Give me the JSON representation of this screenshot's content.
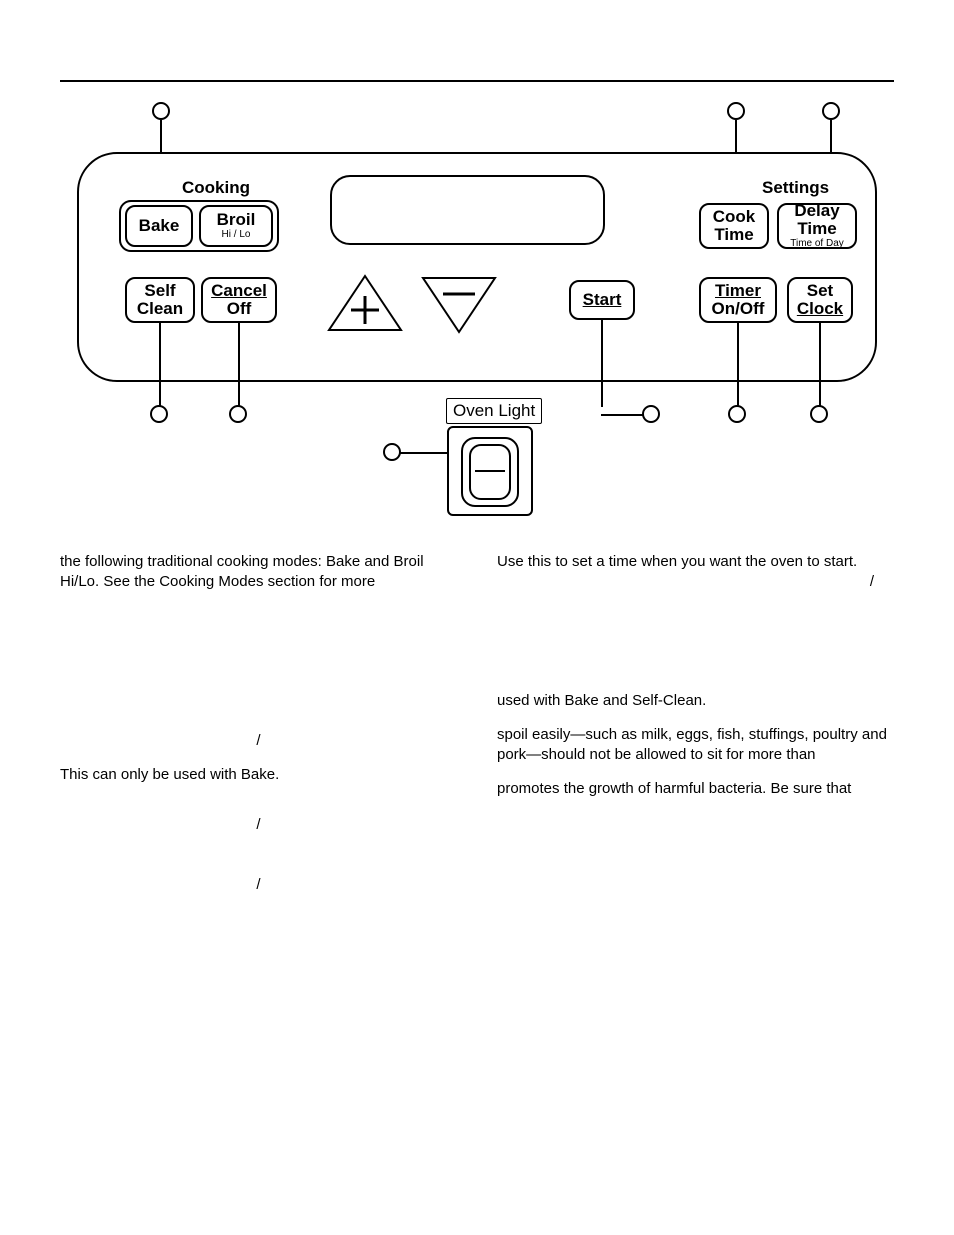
{
  "panel": {
    "cooking_header": "Cooking",
    "settings_header": "Settings",
    "bake": "Bake",
    "broil": "Broil",
    "broil_sub": "Hi / Lo",
    "self_clean_l1": "Self",
    "self_clean_l2": "Clean",
    "cancel_l1": "Cancel",
    "cancel_l2": "Off",
    "start": "Start",
    "cook_time_l1": "Cook",
    "cook_time_l2": "Time",
    "delay_time_l1": "Delay",
    "delay_time_l2": "Time",
    "delay_time_sub": "Time of Day",
    "timer_l1": "Timer",
    "timer_l2": "On/Off",
    "set_clock_l1": "Set",
    "set_clock_l2": "Clock",
    "oven_light": "Oven Light",
    "plus": "+",
    "minus": "–"
  },
  "text": {
    "left1": "the following traditional cooking modes: Bake and Broil Hi/Lo. See the Cooking Modes section for more",
    "left2": "This can only be used with Bake.",
    "right1": "Use this to set a time when you want the oven to start.",
    "right2": "used with Bake and Self-Clean.",
    "right3": "spoil easily—such as milk, eggs, fish, stuffings, poultry and pork—should not be allowed to sit for more than",
    "right4": "promotes the growth of harmful bacteria. Be sure that",
    "slash": "/"
  },
  "page_number": ""
}
